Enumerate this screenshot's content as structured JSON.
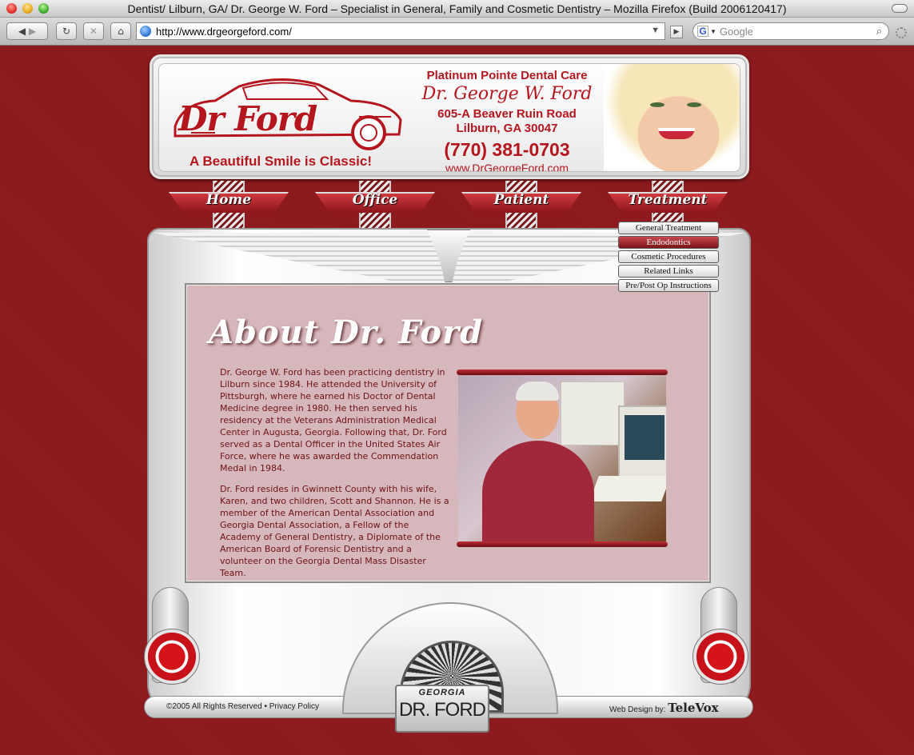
{
  "window": {
    "title": "Dentist/ Lilburn, GA/ Dr. George W. Ford – Specialist in General, Family and Cosmetic Dentistry – Mozilla Firefox (Build 2006120417)"
  },
  "toolbar": {
    "url": "http://www.drgeorgeford.com/",
    "search_placeholder": "Google",
    "search_engine_glyph": "G"
  },
  "header": {
    "logo": "Dr Ford",
    "tagline": "A Beautiful Smile is Classic!",
    "practice": "Platinum Pointe Dental Care",
    "doctor": "Dr. George W. Ford",
    "address_line1": "605-A Beaver Ruin Road",
    "address_line2": "Lilburn, GA 30047",
    "phone": "(770) 381-0703",
    "website": "www.DrGeorgeFord.com"
  },
  "nav": {
    "items": [
      {
        "label": "Home"
      },
      {
        "label": "Office"
      },
      {
        "label": "Patient"
      },
      {
        "label": "Treatment"
      }
    ]
  },
  "submenu": {
    "items": [
      {
        "label": "General Treatment"
      },
      {
        "label": "Endodontics"
      },
      {
        "label": "Cosmetic Procedures"
      },
      {
        "label": "Related Links"
      },
      {
        "label": "Pre/Post Op Instructions"
      }
    ],
    "active_index": 1
  },
  "content": {
    "title": "About Dr. Ford",
    "paragraph1": "Dr. George W. Ford has been practicing dentistry in Lilburn since 1984. He attended the University of Pittsburgh, where he earned his Doctor of Dental Medicine degree in 1980. He then served his residency at the Veterans Administration Medical Center in Augusta, Georgia. Following that, Dr. Ford served as a Dental Officer in the United States Air Force, where he was awarded the Commendation Medal in 1984.",
    "paragraph2": "Dr. Ford resides in Gwinnett County with his wife, Karen, and two children, Scott and Shannon. He is a member of the American Dental Association and Georgia Dental Association, a Fellow of the Academy of General Dentistry, a Diplomate of the American Board of Forensic Dentistry and a volunteer on the Georgia Dental Mass Disaster Team."
  },
  "plate": {
    "state": "GEORGIA",
    "tag": "DR. FORD"
  },
  "footer": {
    "copyright": "©2005 All Rights Reserved",
    "separator": "•",
    "privacy": "Privacy Policy",
    "credit_prefix": "Web Design by:",
    "credit_brand": "TeleVox"
  },
  "colors": {
    "background": "#8f1b1f",
    "brand_red": "#b5161e",
    "content_panel": "#d6b7bb"
  }
}
